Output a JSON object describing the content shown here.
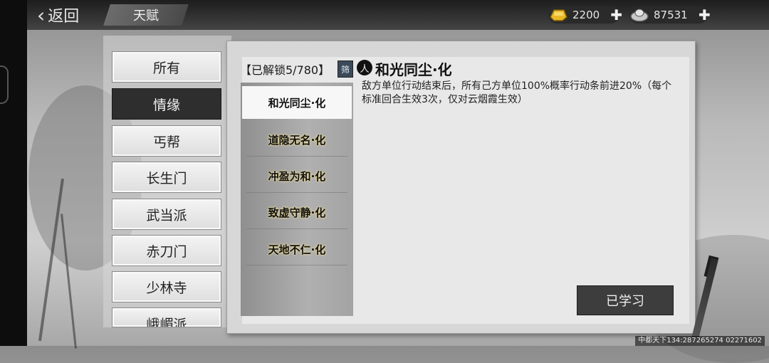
{
  "topbar": {
    "back_label": "返回",
    "title": "天赋",
    "gold": "2200",
    "silver": "87531"
  },
  "categories": [
    {
      "label": "所有",
      "active": false
    },
    {
      "label": "情缘",
      "active": true
    },
    {
      "label": "丐帮",
      "active": false
    },
    {
      "label": "长生门",
      "active": false
    },
    {
      "label": "武当派",
      "active": false
    },
    {
      "label": "赤刀门",
      "active": false
    },
    {
      "label": "少林寺",
      "active": false
    },
    {
      "label": "峨嵋派",
      "active": false
    }
  ],
  "unlock_status": "【已解锁5/780】",
  "filter_label": "筛",
  "skills": [
    {
      "label": "和光同尘·化",
      "active": true
    },
    {
      "label": "道隐无名·化",
      "active": false
    },
    {
      "label": "冲盈为和·化",
      "active": false
    },
    {
      "label": "致虚守静·化",
      "active": false
    },
    {
      "label": "天地不仁·化",
      "active": false
    }
  ],
  "detail": {
    "icon_glyph": "人",
    "title": "和光同尘·化",
    "description": "敌方单位行动结束后，所有己方单位100%概率行动条前进20%（每个标准回合生效3次，仅对云烟霞生效）"
  },
  "learned_label": "已学习",
  "footer_id": "中都天下134:287265274  02271602",
  "colors": {
    "gold": "#e9b825",
    "silver": "#c8c8c8",
    "active_dark": "#2e2e2e"
  }
}
